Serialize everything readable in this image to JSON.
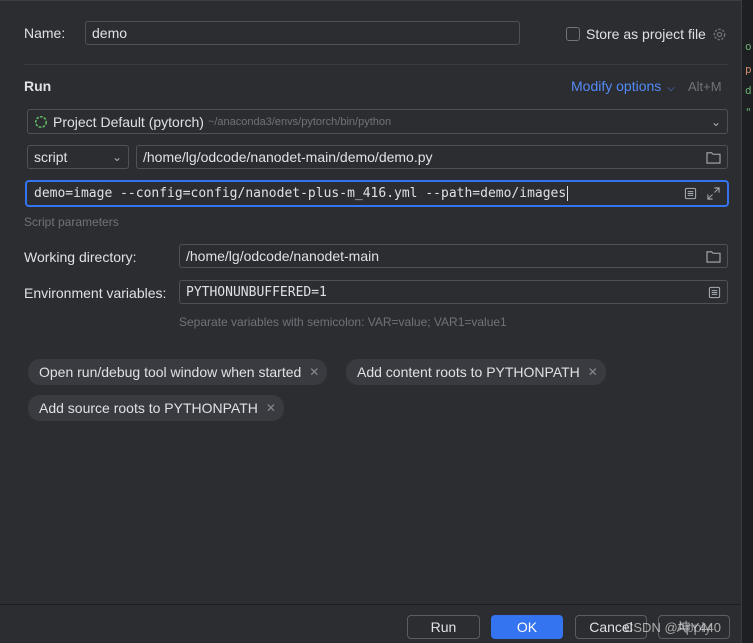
{
  "name": {
    "label": "Name:",
    "value": "demo"
  },
  "store_as_project_file": {
    "label": "Store as project file",
    "checked": false
  },
  "run_section": {
    "title": "Run",
    "modify_options": "Modify options",
    "modify_shortcut": "Alt+M"
  },
  "interpreter": {
    "name": "Project Default (pytorch)",
    "path": "~/anaconda3/envs/pytorch/bin/python"
  },
  "script": {
    "type": "script",
    "path": "/home/lg/odcode/nanodet-main/demo/demo.py"
  },
  "script_parameters": {
    "value": "demo=image --config=config/nanodet-plus-m_416.yml --path=demo/images",
    "hint": "Script parameters"
  },
  "working_directory": {
    "label": "Working directory:",
    "value": "/home/lg/odcode/nanodet-main"
  },
  "environment_variables": {
    "label": "Environment variables:",
    "value": "PYTHONUNBUFFERED=1",
    "hint": "Separate variables with semicolon: VAR=value; VAR1=value1"
  },
  "options": [
    {
      "label": "Open run/debug tool window when started"
    },
    {
      "label": "Add content roots to PYTHONPATH"
    },
    {
      "label": "Add source roots to PYTHONPATH"
    }
  ],
  "footer": {
    "run": "Run",
    "ok": "OK",
    "cancel": "Cancel",
    "apply": "Apply",
    "watermark": "CSDN @坤Y440"
  },
  "colors": {
    "background": "#2b2d30",
    "accent": "#3574f0",
    "link": "#548af7",
    "border": "#4e5157"
  }
}
